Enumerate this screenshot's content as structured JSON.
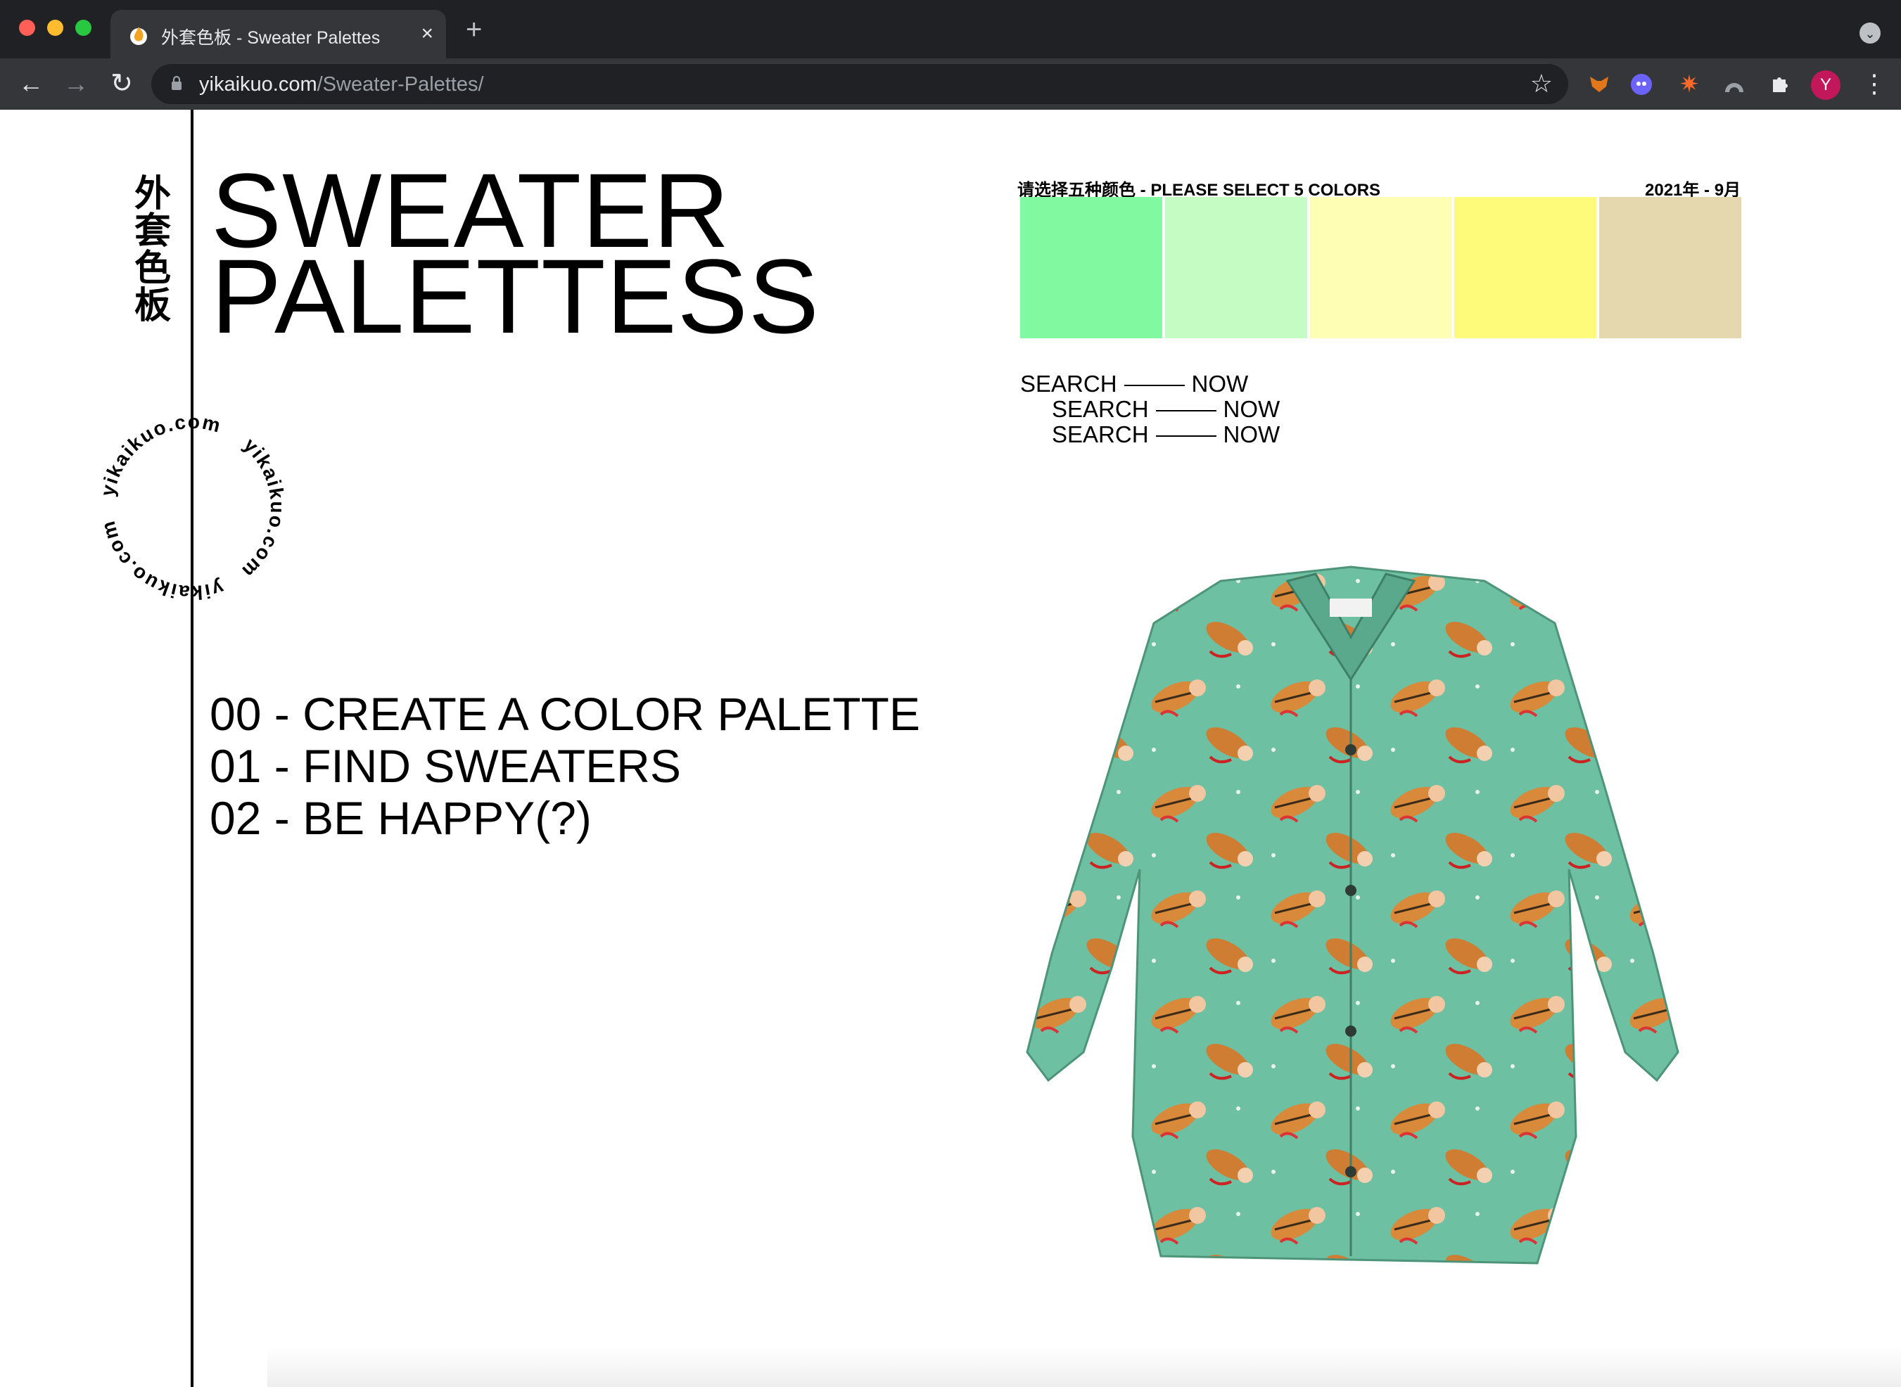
{
  "browser": {
    "tab": {
      "title": "外套色板 - Sweater Palettes",
      "close_icon": "×"
    },
    "new_tab_icon": "+",
    "tab_menu_icon": "⌄",
    "nav": {
      "back": "←",
      "forward": "→",
      "reload": "↻"
    },
    "url": {
      "host": "yikaikuo.com",
      "path": "/Sweater-Palettes/"
    },
    "bookmark_icon": "☆",
    "extensions": [
      "fox-extension",
      "ghost-extension",
      "burst-extension",
      "arc-extension",
      "puzzle-extension"
    ],
    "profile_initial": "Y",
    "menu_icon": "⋮"
  },
  "page": {
    "vertical_title": "外套色板",
    "title_lines": [
      "SWEATER",
      "PALETTESS"
    ],
    "badge_text": "yikaikuo.com",
    "steps": [
      "00 - CREATE A COLOR PALETTE",
      "01 - FIND SWEATERS",
      "02 - BE HAPPY(?)"
    ],
    "palette": {
      "heading": "请选择五种颜色 - PLEASE SELECT 5 COLORS",
      "date": "2021年 - 9月",
      "colors": [
        "#80f9a0",
        "#c4fcc4",
        "#fefeb4",
        "#fefa7a",
        "#e6d8ae"
      ]
    },
    "search_links": [
      {
        "left": "SEARCH",
        "right": "NOW"
      },
      {
        "left": "SEARCH",
        "right": "NOW"
      },
      {
        "left": "SEARCH",
        "right": "NOW"
      }
    ]
  }
}
